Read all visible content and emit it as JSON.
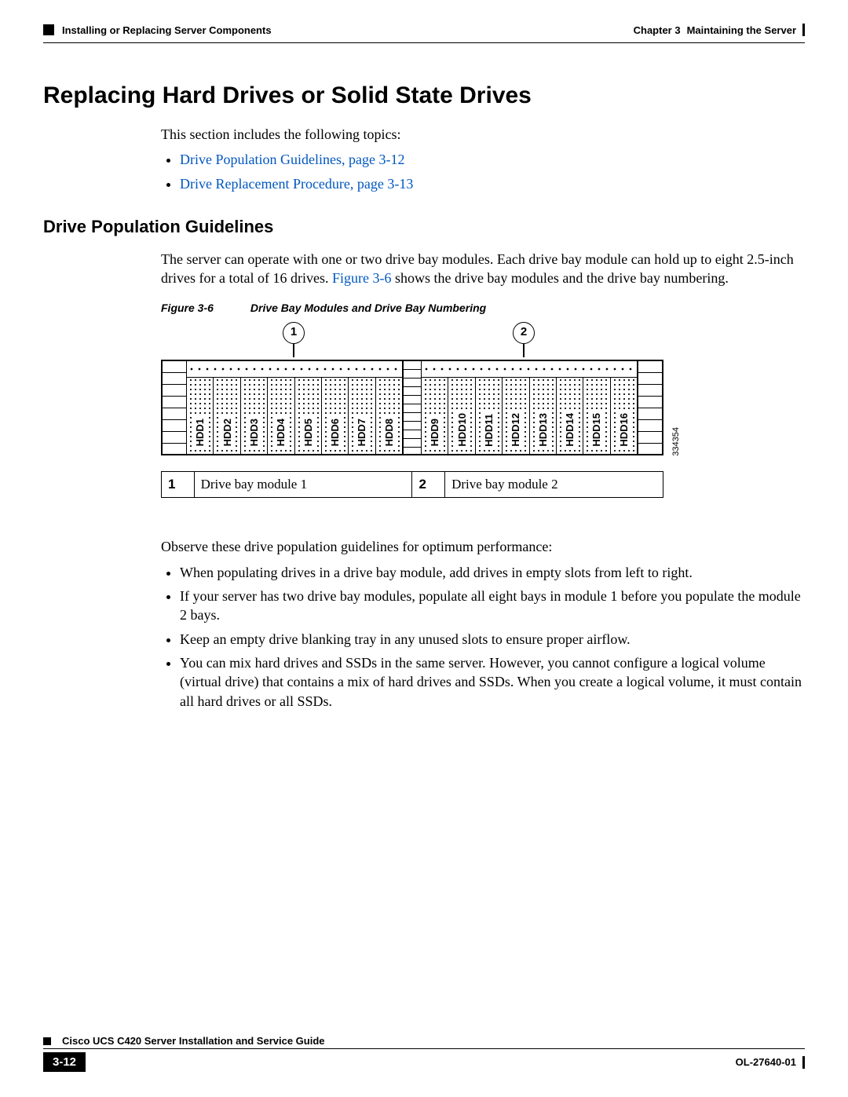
{
  "header": {
    "left": "Installing or Replacing Server Components",
    "chapter_label": "Chapter 3",
    "chapter_title": "Maintaining the Server"
  },
  "title": "Replacing Hard Drives or Solid State Drives",
  "intro": "This section includes the following topics:",
  "topic_links": [
    "Drive Population Guidelines, page 3-12",
    "Drive Replacement Procedure, page 3-13"
  ],
  "subsection": "Drive Population Guidelines",
  "para1a": "The server can operate with one or two drive bay modules. Each drive bay module can hold up to eight 2.5-inch drives for a total of 16 drives. ",
  "fig_xref": "Figure 3-6",
  "para1b": " shows the drive bay modules and the drive bay numbering.",
  "figure": {
    "label": "Figure 3-6",
    "title": "Drive Bay Modules and Drive Bay Numbering",
    "callouts": [
      "1",
      "2"
    ],
    "module1": [
      "HDD1",
      "HDD2",
      "HDD3",
      "HDD4",
      "HDD5",
      "HDD6",
      "HDD7",
      "HDD8"
    ],
    "module2": [
      "HDD9",
      "HDD10",
      "HDD11",
      "HDD12",
      "HDD13",
      "HDD14",
      "HDD15",
      "HDD16"
    ],
    "id": "334354"
  },
  "legend": [
    {
      "num": "1",
      "desc": "Drive bay module 1"
    },
    {
      "num": "2",
      "desc": "Drive bay module 2"
    }
  ],
  "observe_intro": "Observe these drive population guidelines for optimum performance:",
  "guidelines": [
    "When populating drives in a drive bay module, add drives in empty slots from left to right.",
    "If your server has two drive bay modules, populate all eight bays in module 1 before you populate the module 2 bays.",
    "Keep an empty drive blanking tray in any unused slots to ensure proper airflow.",
    "You can mix hard drives and SSDs in the same server. However, you cannot configure a logical volume (virtual drive) that contains a mix of hard drives and SSDs. When you create a logical volume, it must contain all hard drives or all SSDs."
  ],
  "footer": {
    "guide": "Cisco UCS C420 Server Installation and Service Guide",
    "page": "3-12",
    "doc": "OL-27640-01"
  }
}
